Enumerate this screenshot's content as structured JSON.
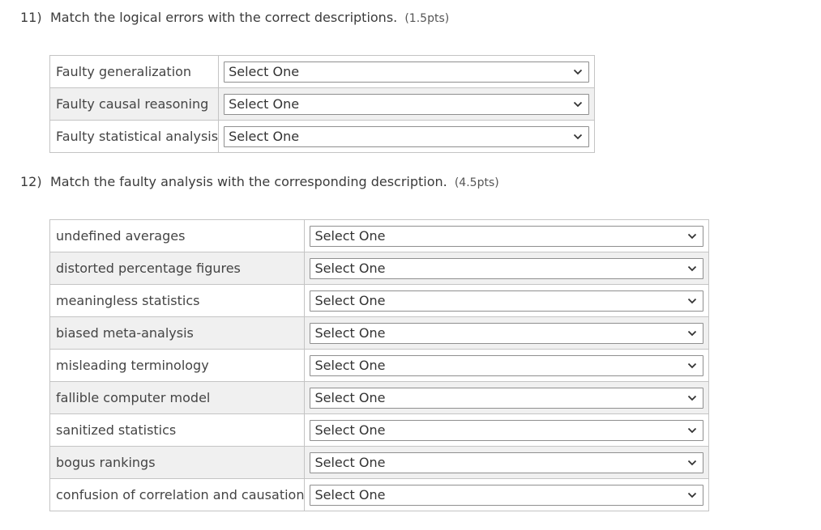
{
  "q11": {
    "number": "11)",
    "prompt": "Match the logical errors with the correct descriptions.",
    "points": "(1.5pts)",
    "rows": [
      {
        "term": "Faulty generalization",
        "selected": "Select One"
      },
      {
        "term": "Faulty causal reasoning",
        "selected": "Select One"
      },
      {
        "term": "Faulty statistical analysis",
        "selected": "Select One"
      }
    ]
  },
  "q12": {
    "number": "12)",
    "prompt": "Match the faulty analysis with the corresponding description.",
    "points": "(4.5pts)",
    "rows": [
      {
        "term": "undefined averages",
        "selected": "Select One"
      },
      {
        "term": "distorted percentage figures",
        "selected": "Select One"
      },
      {
        "term": "meaningless statistics",
        "selected": "Select One"
      },
      {
        "term": "biased meta-analysis",
        "selected": "Select One"
      },
      {
        "term": "misleading terminology",
        "selected": "Select One"
      },
      {
        "term": "fallible computer model",
        "selected": "Select One"
      },
      {
        "term": "sanitized statistics",
        "selected": "Select One"
      },
      {
        "term": "bogus rankings",
        "selected": "Select One"
      },
      {
        "term": "confusion of correlation and causation",
        "selected": "Select One"
      }
    ]
  },
  "icons": {
    "dropdown": "chevron-down-icon"
  }
}
